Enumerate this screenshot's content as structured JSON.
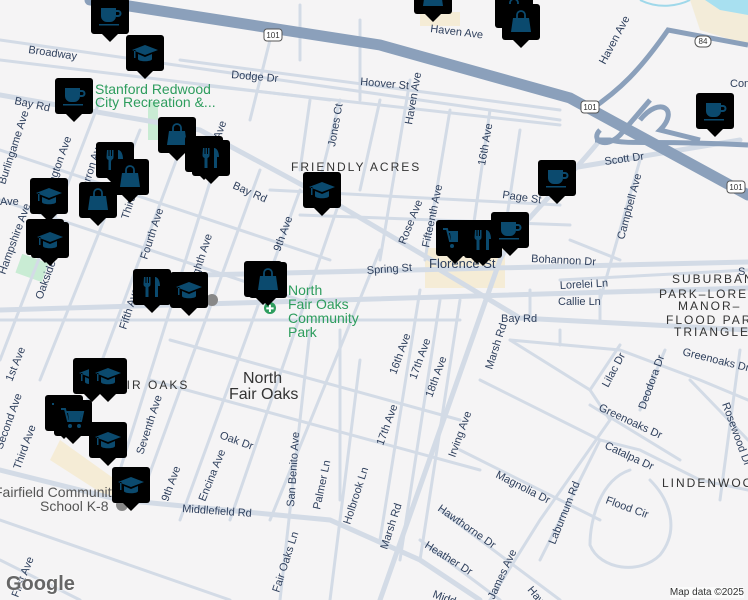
{
  "map": {
    "highways": [
      "101",
      "101",
      "101",
      "84"
    ],
    "roads": [
      "Broadway",
      "Dodge Dr",
      "Hoover St",
      "Haven Ave",
      "Haven Ave",
      "Haven Ave",
      "Bay Rd",
      "Bay Rd",
      "Bay Rd",
      "Jones Ct",
      "9th Ave",
      "9th Ave",
      "Rose Ave",
      "Fifteenth Ave",
      "16th Ave",
      "Page St",
      "Scott Dr",
      "Campbell Ave",
      "Spring St",
      "Bohannon Dr",
      "Lorelei Ln",
      "Callie Ln",
      "Marsh Rd",
      "Marsh Rd",
      "16th Ave",
      "17th Ave",
      "18th Ave",
      "17th Ave",
      "Irving Ave",
      "Holbrook Ln",
      "Palmer Ln",
      "San Benito Ave",
      "Fair Oaks Ln",
      "Oak Dr",
      "Encina Ave",
      "Middlefield Rd",
      "Greenoaks Dr",
      "Greenoaks Dr",
      "Lilac Dr",
      "Deodora Dr",
      "Rosewood Dr",
      "Catalpa Dr",
      "Magnolia Dr",
      "Laburnum Rd",
      "Flood Cir",
      "Hawthorne Dr",
      "Heather Dr",
      "James Ave",
      "Third Ave",
      "Fourth Ave",
      "Fifth Ave",
      "Seventh Ave",
      "Eighth Ave",
      "Barron Ave",
      "Warrington Ave",
      "Burlingame Ave",
      "Hampshire Ave",
      "Oakside Ave",
      "1st Ave",
      "Second Ave",
      "Third Ave",
      "First Ave",
      "Conn",
      "Midd",
      "Haw",
      "Ave",
      "Ave",
      "S",
      "Florence St"
    ],
    "neighborhoods": [
      "FRIENDLY ACRES",
      "SUBURBAN",
      "PARK–LORELEI",
      "MANOR–",
      "FLOOD PARK",
      "TRIANGLE",
      "LINDENWOOD",
      "FAIR OAKS"
    ],
    "towns": [
      "North",
      "Fair Oaks"
    ],
    "places": [
      "Stanford Redwood",
      "City Recreation &...",
      "North",
      "Fair Oaks",
      "Community",
      "Park",
      "Fairfield Community",
      "School K-8"
    ],
    "markers": [
      "coffee",
      "school",
      "coffee",
      "shopping",
      "restaurant",
      "restaurant",
      "school",
      "restaurant",
      "shopping",
      "shopping",
      "school",
      "school",
      "school",
      "restaurant",
      "school",
      "shopping",
      "shopping",
      "school",
      "school",
      "grocery",
      "grocery",
      "school",
      "school",
      "shopping",
      "shopping",
      "shopping",
      "coffee",
      "grocery",
      "restaurant",
      "restaurant",
      "coffee",
      "coffee"
    ]
  },
  "attribution": "Map data ©2025",
  "logo": "Google"
}
